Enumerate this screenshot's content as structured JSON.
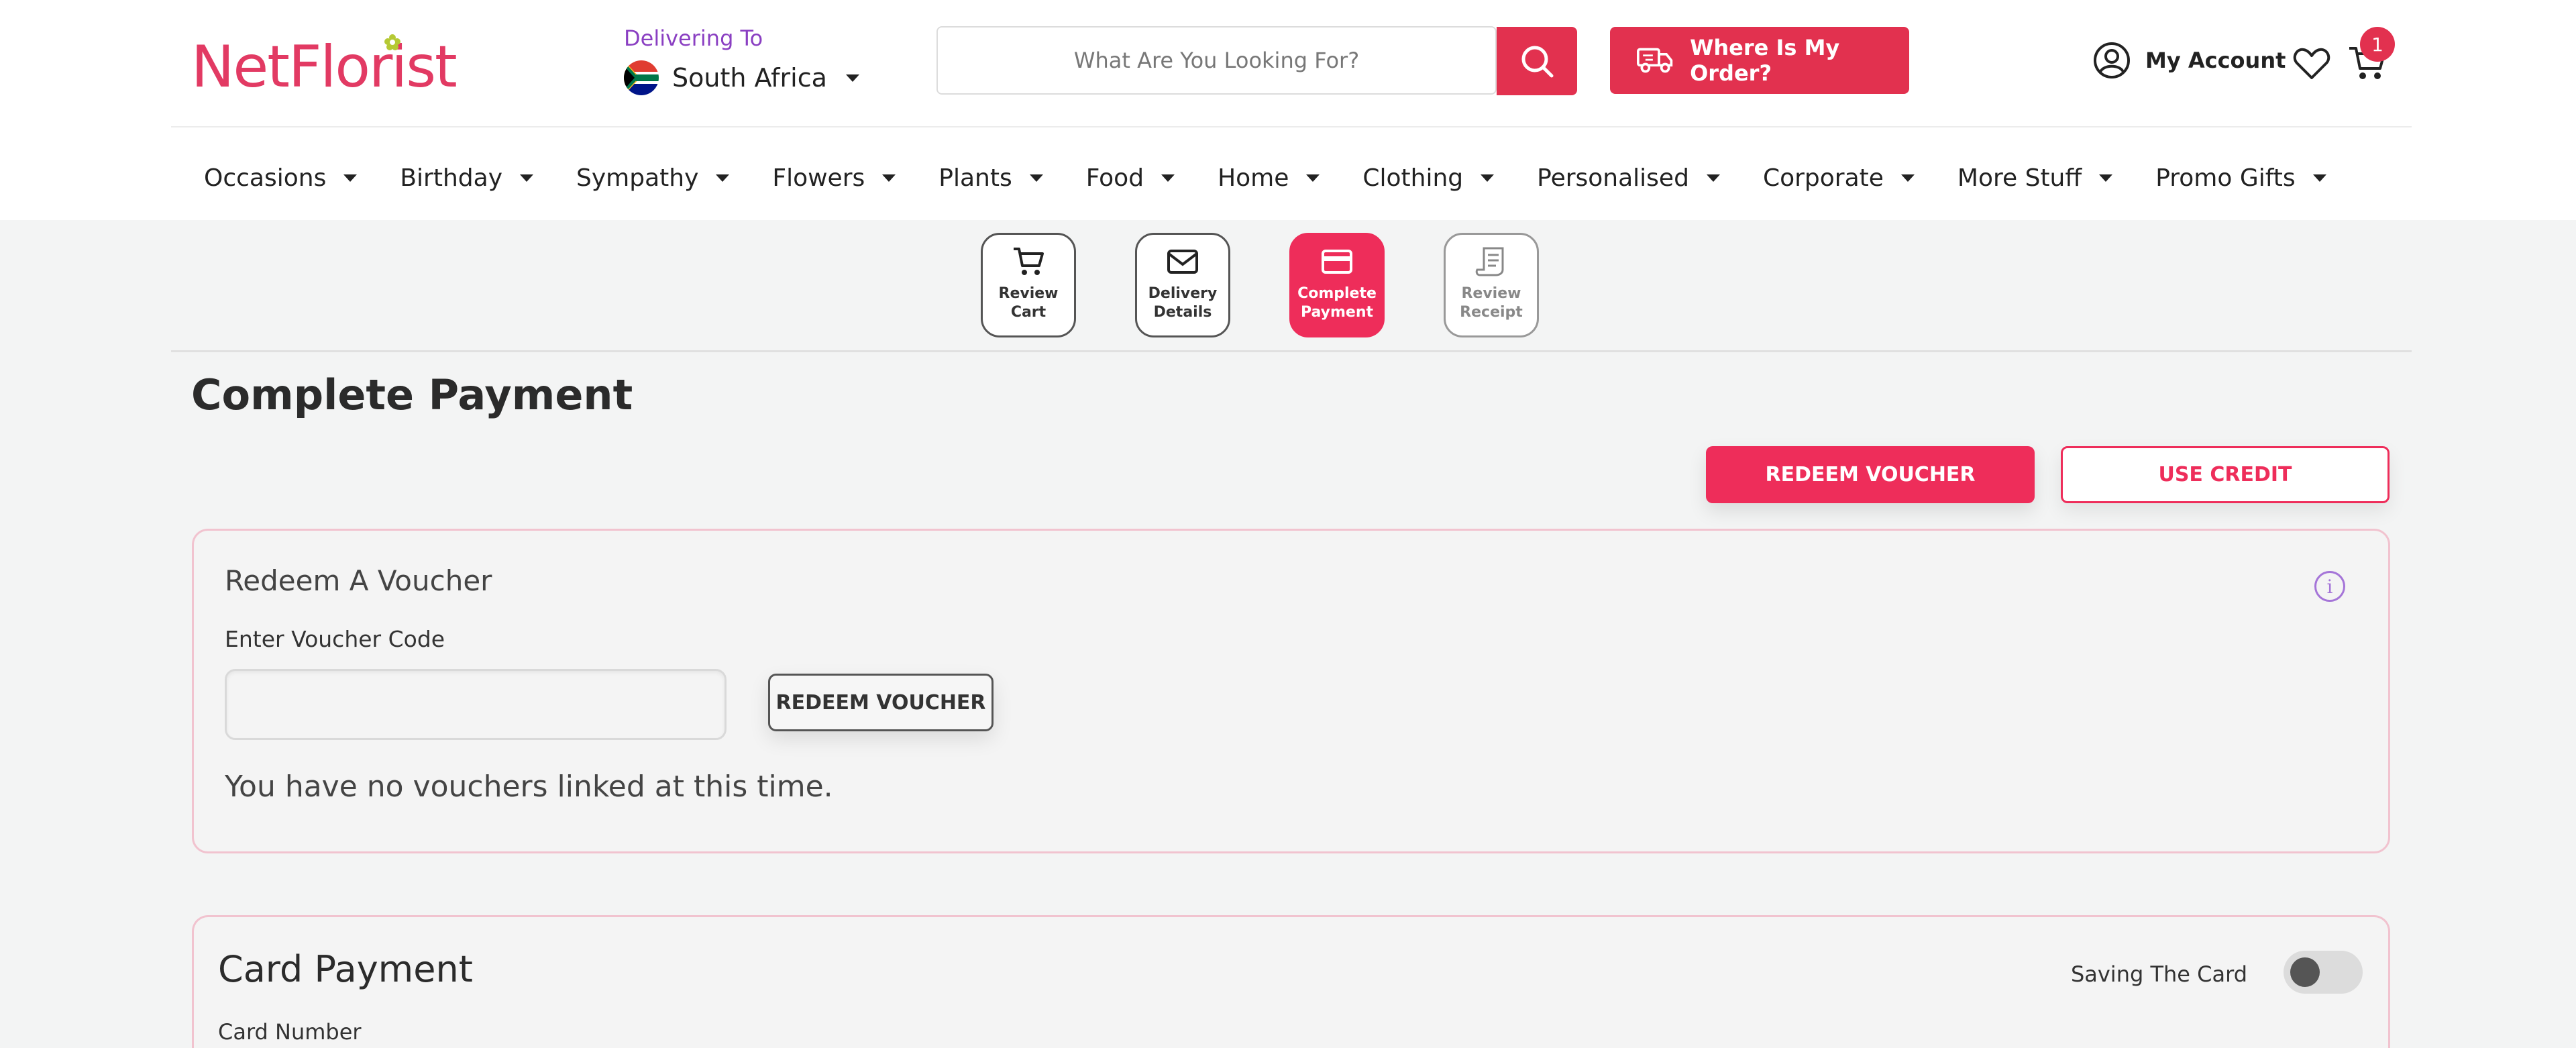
{
  "header": {
    "logo": "NetFlorist",
    "delivering_label": "Delivering To",
    "country": "South Africa",
    "search_placeholder": "What Are You Looking For?",
    "order_button": "Where Is My Order?",
    "account_label": "My Account",
    "cart_count": "1"
  },
  "nav": {
    "items": [
      "Occasions",
      "Birthday",
      "Sympathy",
      "Flowers",
      "Plants",
      "Food",
      "Home",
      "Clothing",
      "Personalised",
      "Corporate",
      "More Stuff",
      "Promo Gifts"
    ]
  },
  "steps": [
    {
      "label": "Review\nCart",
      "icon": "cart-icon",
      "state": "done"
    },
    {
      "label": "Delivery\nDetails",
      "icon": "envelope-icon",
      "state": "done"
    },
    {
      "label": "Complete\nPayment",
      "icon": "credit-card-icon",
      "state": "active"
    },
    {
      "label": "Review\nReceipt",
      "icon": "receipt-icon",
      "state": "disabled"
    }
  ],
  "page": {
    "title": "Complete Payment",
    "redeem_voucher_button": "REDEEM VOUCHER",
    "use_credit_button": "USE CREDIT"
  },
  "voucher": {
    "title": "Redeem A Voucher",
    "code_label": "Enter Voucher Code",
    "code_value": "",
    "redeem_button": "REDEEM VOUCHER",
    "empty_message": "You have no vouchers linked at this time."
  },
  "card_payment": {
    "title": "Card Payment",
    "save_card_label": "Saving The Card",
    "save_card_enabled": false,
    "card_number_label": "Card Number"
  },
  "colors": {
    "brand": "#e2314f",
    "accent_pink": "#ee2d5a",
    "purple": "#8a3fc2"
  }
}
